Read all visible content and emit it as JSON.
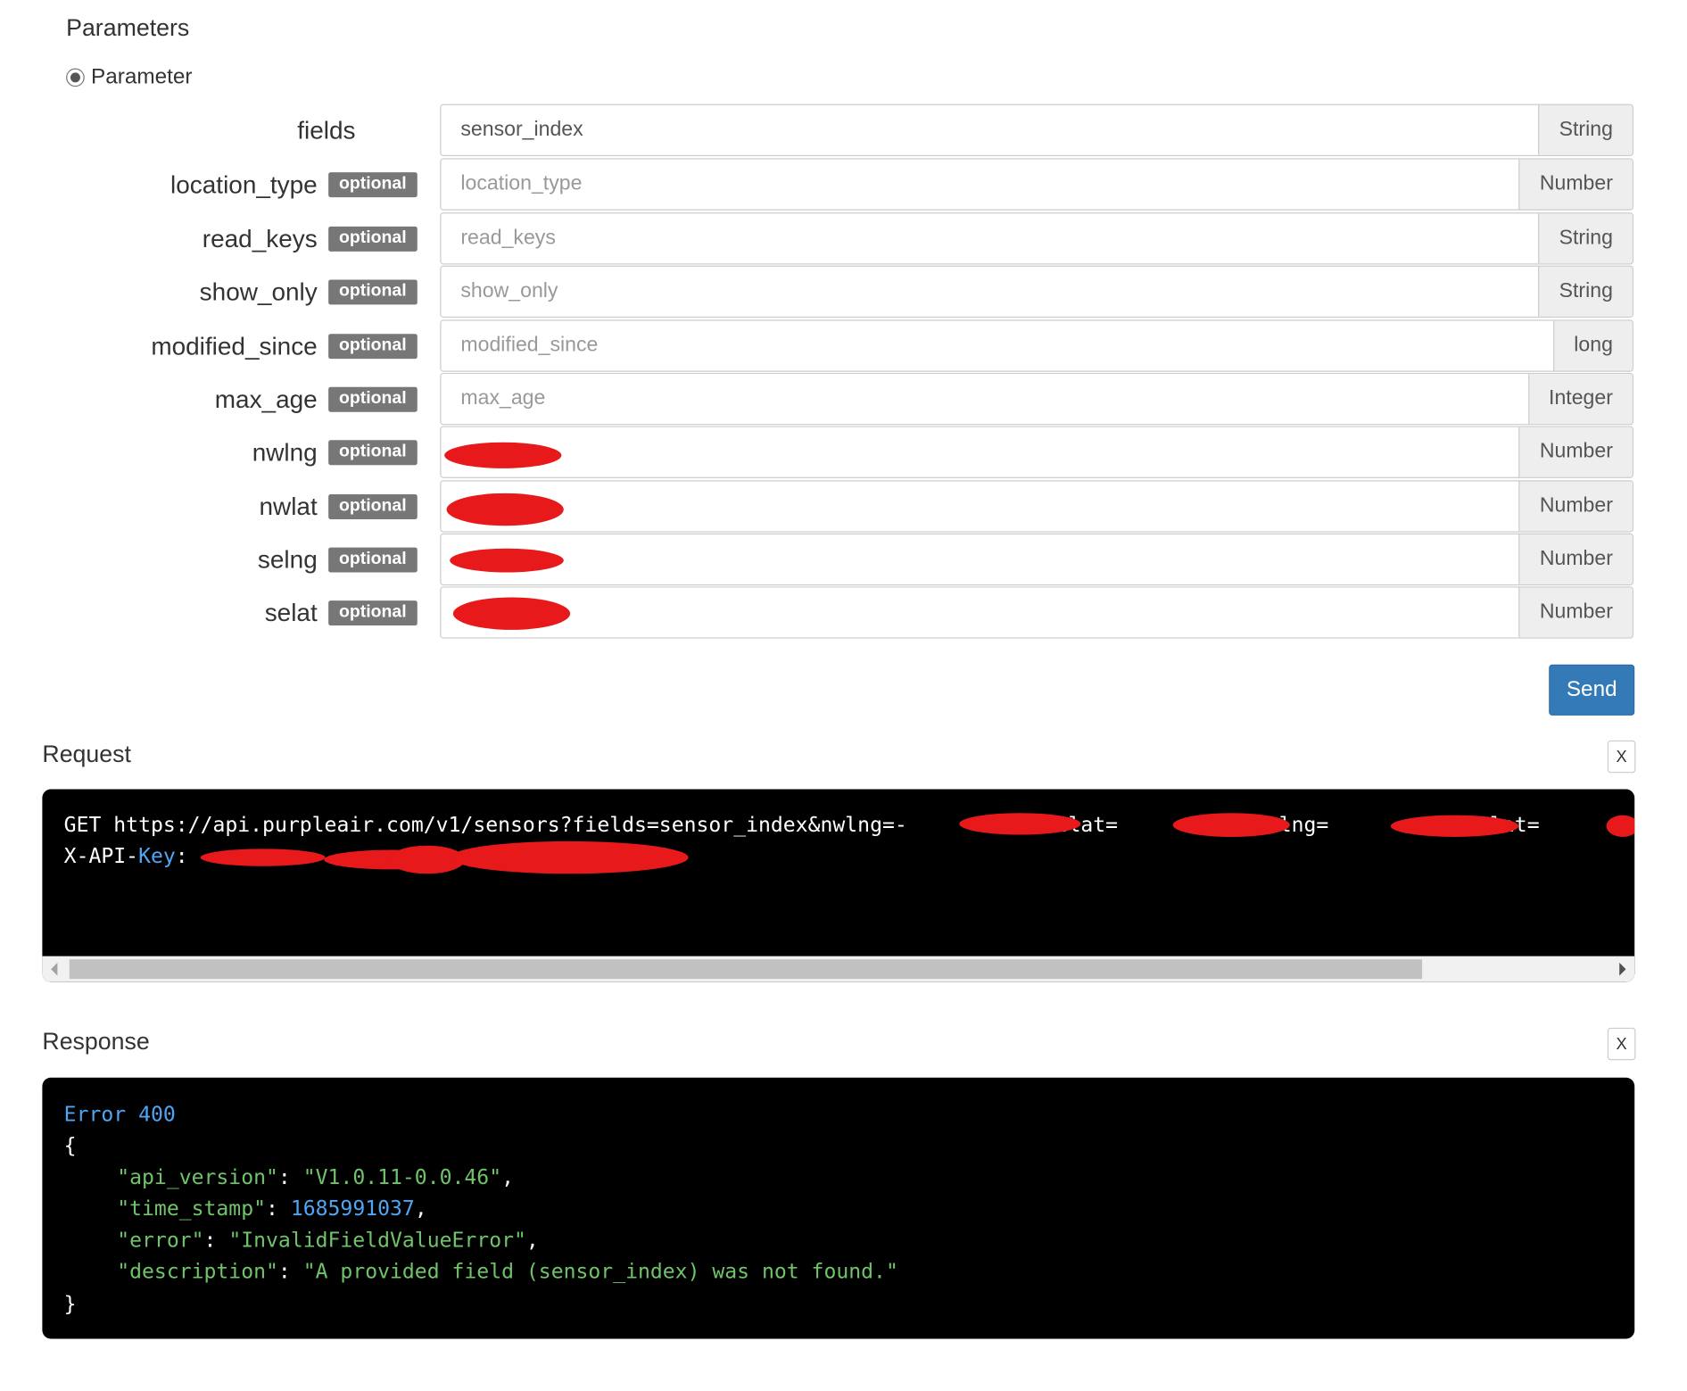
{
  "parameters_title": "Parameters",
  "radio_label": "Parameter",
  "params": [
    {
      "name": "fields",
      "optional": false,
      "value": "sensor_index",
      "placeholder": "",
      "type": "String"
    },
    {
      "name": "location_type",
      "optional": true,
      "value": "",
      "placeholder": "location_type",
      "type": "Number"
    },
    {
      "name": "read_keys",
      "optional": true,
      "value": "",
      "placeholder": "read_keys",
      "type": "String"
    },
    {
      "name": "show_only",
      "optional": true,
      "value": "",
      "placeholder": "show_only",
      "type": "String"
    },
    {
      "name": "modified_since",
      "optional": true,
      "value": "",
      "placeholder": "modified_since",
      "type": "long"
    },
    {
      "name": "max_age",
      "optional": true,
      "value": "",
      "placeholder": "max_age",
      "type": "Integer"
    },
    {
      "name": "nwlng",
      "optional": true,
      "value": "",
      "placeholder": "",
      "type": "Number",
      "redacted": true
    },
    {
      "name": "nwlat",
      "optional": true,
      "value": "",
      "placeholder": "",
      "type": "Number",
      "redacted": true
    },
    {
      "name": "selng",
      "optional": true,
      "value": "",
      "placeholder": "",
      "type": "Number",
      "redacted": true
    },
    {
      "name": "selat",
      "optional": true,
      "value": "",
      "placeholder": "",
      "type": "Number",
      "redacted": true
    }
  ],
  "optional_badge": "optional",
  "send_label": "Send",
  "request": {
    "title": "Request",
    "close_label": "X",
    "line1": "GET https://api.purpleair.com/v1/sensors?fields=sensor_index&nwlng=-          &nwlat=          &selng=          &selat=",
    "line2_key": "X-API-",
    "line2_key_blue": "Key",
    "line2_colon": ":"
  },
  "response": {
    "title": "Response",
    "close_label": "X",
    "error_word": "Error",
    "error_code": "400",
    "open_brace": "{",
    "close_brace": "}",
    "fields": [
      {
        "key": "\"api_version\"",
        "value": "\"V1.0.11-0.0.46\"",
        "kind": "string",
        "comma": ","
      },
      {
        "key": "\"time_stamp\"",
        "value": "1685991037",
        "kind": "number",
        "comma": ","
      },
      {
        "key": "\"error\"",
        "value": "\"InvalidFieldValueError\"",
        "kind": "string",
        "comma": ","
      },
      {
        "key": "\"description\"",
        "value": "\"A provided field (sensor_index) was not found.\"",
        "kind": "string",
        "comma": ""
      }
    ]
  },
  "colors": {
    "send_button": "#337ab7",
    "badge": "#777777",
    "code_bg": "#000000",
    "code_blue": "#4ea6f5",
    "code_green": "#6fc46a",
    "redaction": "#e8191a"
  }
}
